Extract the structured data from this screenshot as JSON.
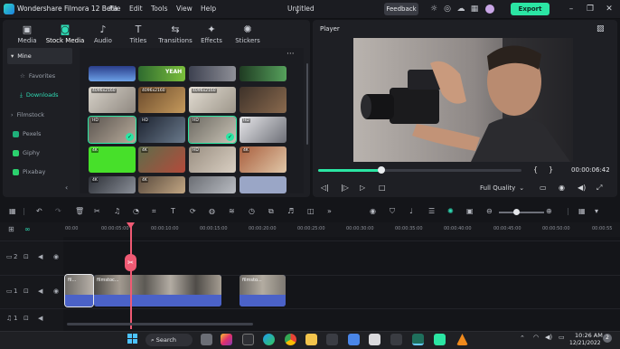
{
  "titlebar": {
    "app_title": "Wondershare Filmora 12 Beta",
    "menus": [
      "File",
      "Edit",
      "Tools",
      "View",
      "Help"
    ],
    "document_title": "Untitled",
    "feedback_label": "Feedback",
    "export_label": "Export",
    "icons": [
      "lightbulb-icon",
      "headset-icon",
      "cloud-icon",
      "grid-icon",
      "avatar"
    ],
    "window_controls": [
      "minimize-icon",
      "restore-icon",
      "close-icon"
    ]
  },
  "media": {
    "tabs": [
      {
        "label": "Media",
        "icon": "media-icon",
        "glyph": "▣"
      },
      {
        "label": "Stock Media",
        "icon": "stock-media-icon",
        "glyph": "◙"
      },
      {
        "label": "Audio",
        "icon": "music-note-icon",
        "glyph": "♪"
      },
      {
        "label": "Titles",
        "icon": "text-icon",
        "glyph": "T"
      },
      {
        "label": "Transitions",
        "icon": "transitions-icon",
        "glyph": "⇆"
      },
      {
        "label": "Effects",
        "icon": "effects-icon",
        "glyph": "✦"
      },
      {
        "label": "Stickers",
        "icon": "stickers-icon",
        "glyph": "✺"
      }
    ],
    "active_tab": "Stock Media",
    "sidebar": {
      "mine_label": "Mine",
      "items": [
        "Favorites",
        "Downloads",
        "Filmstock",
        "Pexels",
        "Giphy",
        "Pixabay"
      ],
      "active_item": "Downloads"
    },
    "thumb_labels": [
      "4096x2160",
      "4096x2160",
      "4096x2160",
      "HD",
      "HD",
      "HD",
      "HD",
      "4K",
      "4K",
      "HD",
      "4K",
      "4K",
      "4K"
    ]
  },
  "player": {
    "label": "Player",
    "current_time": "00:00:06:42",
    "quality": "Full Quality",
    "progress_fraction": 0.31
  },
  "timeline": {
    "ruler_ticks": [
      "00:00",
      "00:00:05:00",
      "00:00:10:00",
      "00:00:15:00",
      "00:00:20:00",
      "00:00:25:00",
      "00:00:30:00",
      "00:00:35:00",
      "00:00:40:00",
      "00:00:45:00",
      "00:00:50:00",
      "00:00:55"
    ],
    "tracks": [
      {
        "label": "2",
        "kind": "video"
      },
      {
        "label": "1",
        "kind": "video"
      },
      {
        "label": "1",
        "kind": "audio"
      }
    ],
    "clips": [
      {
        "label": "fil..."
      },
      {
        "label": "filmstoc..."
      },
      {
        "label": "filmsto..."
      }
    ]
  },
  "taskbar": {
    "search_label": "Search",
    "time": "10:26 AM",
    "date": "12/21/2022",
    "notification_count": "2"
  }
}
